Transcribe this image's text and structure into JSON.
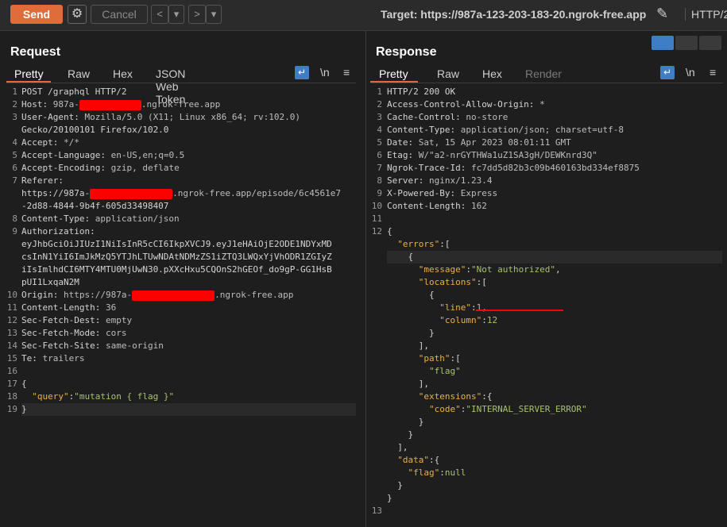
{
  "toolbar": {
    "send_label": "Send",
    "gear_glyph": "⚙",
    "cancel_label": "Cancel",
    "back_glyph": "<",
    "back_drop_glyph": "▾",
    "fwd_glyph": ">",
    "fwd_drop_glyph": "▾",
    "target_text": "Target: https://987a-123-203-183-20.ngrok-free.app",
    "pencil_glyph": "✎",
    "protocol": "HTTP/2"
  },
  "request": {
    "title": "Request",
    "tabs": [
      "Pretty",
      "Raw",
      "Hex",
      "JSON Web Token"
    ],
    "wrap_icon_glyph": "↵",
    "newline_icon": "\\n",
    "menu_glyph": "≡",
    "line_numbers": [
      "1",
      "2",
      "3",
      "",
      "4",
      "5",
      "6",
      "7",
      "",
      "",
      "8",
      "9",
      "",
      "",
      "",
      "",
      "10",
      "11",
      "12",
      "13",
      "14",
      "15",
      "16",
      "17",
      "18",
      "19"
    ],
    "lines": [
      {
        "t": "POST /graphql HTTP/2"
      },
      {
        "k": "Host",
        "v": "987a-",
        "r": 78,
        "v2": ".ngrok-free.app"
      },
      {
        "k": "User-Agent",
        "v": "Mozilla/5.0 (X11; Linux x86_64; rv:102.0)"
      },
      {
        "t": "Gecko/20100101 Firefox/102.0"
      },
      {
        "k": "Accept",
        "v": "*/*"
      },
      {
        "k": "Accept-Language",
        "v": "en-US,en;q=0.5"
      },
      {
        "k": "Accept-Encoding",
        "v": "gzip, deflate"
      },
      {
        "k": "Referer",
        "v": ""
      },
      {
        "t": "https://987a-",
        "r": 104,
        "v2": ".ngrok-free.app/episode/6c4561e7"
      },
      {
        "t": "-2d88-4844-9b4f-605d33498407"
      },
      {
        "k": "Content-Type",
        "v": "application/json"
      },
      {
        "k": "Authorization",
        "v": ""
      },
      {
        "t": "eyJhbGciOiJIUzI1NiIsInR5cCI6IkpXVCJ9.eyJ1eHAiOjE2ODE1NDYxMD"
      },
      {
        "t": "csInN1YiI6ImJkMzQ5YTJhLTUwNDAtNDMzZS1iZTQ3LWQxYjVhODR1ZGIyZ"
      },
      {
        "t": "iIsImlhdCI6MTY4MTU0MjUwN30.pXXcHxu5CQOnS2hGEOf_do9gP-GG1HsB"
      },
      {
        "t": "pUI1LxqaN2M"
      },
      {
        "k": "Origin",
        "v": "https://987a-",
        "r": 104,
        "v2": ".ngrok-free.app"
      },
      {
        "k": "Content-Length",
        "v": "36"
      },
      {
        "k": "Sec-Fetch-Dest",
        "v": "empty"
      },
      {
        "k": "Sec-Fetch-Mode",
        "v": "cors"
      },
      {
        "k": "Sec-Fetch-Site",
        "v": "same-origin"
      },
      {
        "k": "Te",
        "v": "trailers"
      },
      {
        "t": ""
      },
      {
        "t": "{"
      },
      {
        "json": "  \"query\":\"mutation { flag }\""
      },
      {
        "t": "}",
        "hl": true
      }
    ]
  },
  "response": {
    "title": "Response",
    "tabs": [
      "Pretty",
      "Raw",
      "Hex",
      "Render"
    ],
    "wrap_icon_glyph": "↵",
    "newline_icon": "\\n",
    "menu_glyph": "≡",
    "line_numbers": [
      "1",
      "2",
      "3",
      "4",
      "5",
      "6",
      "7",
      "8",
      "9",
      "10",
      "11",
      "12",
      "",
      "",
      "",
      "",
      "",
      "",
      "",
      "",
      "",
      "",
      "",
      "",
      "",
      "",
      "",
      "",
      "",
      "",
      "",
      "",
      "",
      "13"
    ],
    "lines": [
      {
        "t": "HTTP/2 200 OK"
      },
      {
        "k": "Access-Control-Allow-Origin",
        "v": "*"
      },
      {
        "k": "Cache-Control",
        "v": "no-store"
      },
      {
        "k": "Content-Type",
        "v": "application/json; charset=utf-8"
      },
      {
        "k": "Date",
        "v": "Sat, 15 Apr 2023 08:01:11 GMT"
      },
      {
        "k": "Etag",
        "v": "W/\"a2-nrGYTHWa1uZ1SA3gH/DEWKnrd3Q\""
      },
      {
        "k": "Ngrok-Trace-Id",
        "v": "fc7dd5d82b3c09b460163bd334ef8875"
      },
      {
        "k": "Server",
        "v": "nginx/1.23.4"
      },
      {
        "k": "X-Powered-By",
        "v": "Express"
      },
      {
        "k": "Content-Length",
        "v": "162"
      },
      {
        "t": ""
      },
      {
        "t": "{"
      },
      {
        "j": [
          [
            "p",
            "  "
          ],
          [
            "key",
            "\"errors\""
          ],
          [
            "p",
            ":["
          ]
        ]
      },
      {
        "j": [
          [
            "p",
            "    {"
          ]
        ],
        "hl": true
      },
      {
        "j": [
          [
            "p",
            "      "
          ],
          [
            "key",
            "\"message\""
          ],
          [
            "p",
            ":"
          ],
          [
            "str",
            "\"Not authorized\""
          ],
          [
            "p",
            ","
          ]
        ]
      },
      {
        "j": [
          [
            "p",
            "      "
          ],
          [
            "key",
            "\"locations\""
          ],
          [
            "p",
            ":["
          ]
        ]
      },
      {
        "j": [
          [
            "p",
            "        {"
          ]
        ]
      },
      {
        "j": [
          [
            "p",
            "          "
          ],
          [
            "key",
            "\"line\""
          ],
          [
            "p",
            ":"
          ],
          [
            "num",
            "1"
          ],
          [
            "p",
            ","
          ]
        ]
      },
      {
        "j": [
          [
            "p",
            "          "
          ],
          [
            "key",
            "\"column\""
          ],
          [
            "p",
            ":"
          ],
          [
            "num",
            "12"
          ]
        ]
      },
      {
        "j": [
          [
            "p",
            "        }"
          ]
        ]
      },
      {
        "j": [
          [
            "p",
            "      ],"
          ]
        ]
      },
      {
        "j": [
          [
            "p",
            "      "
          ],
          [
            "key",
            "\"path\""
          ],
          [
            "p",
            ":["
          ]
        ]
      },
      {
        "j": [
          [
            "p",
            "        "
          ],
          [
            "str",
            "\"flag\""
          ]
        ]
      },
      {
        "j": [
          [
            "p",
            "      ],"
          ]
        ]
      },
      {
        "j": [
          [
            "p",
            "      "
          ],
          [
            "key",
            "\"extensions\""
          ],
          [
            "p",
            ":{"
          ]
        ]
      },
      {
        "j": [
          [
            "p",
            "        "
          ],
          [
            "key",
            "\"code\""
          ],
          [
            "p",
            ":"
          ],
          [
            "str",
            "\"INTERNAL_SERVER_ERROR\""
          ]
        ]
      },
      {
        "j": [
          [
            "p",
            "      }"
          ]
        ]
      },
      {
        "j": [
          [
            "p",
            "    }"
          ]
        ]
      },
      {
        "j": [
          [
            "p",
            "  ],"
          ]
        ]
      },
      {
        "j": [
          [
            "p",
            "  "
          ],
          [
            "key",
            "\"data\""
          ],
          [
            "p",
            ":{"
          ]
        ]
      },
      {
        "j": [
          [
            "p",
            "    "
          ],
          [
            "key",
            "\"flag\""
          ],
          [
            "p",
            ":"
          ],
          [
            "num",
            "null"
          ]
        ]
      },
      {
        "j": [
          [
            "p",
            "  }"
          ]
        ]
      },
      {
        "j": [
          [
            "p",
            "}"
          ]
        ]
      },
      {
        "t": ""
      }
    ]
  },
  "colors": {
    "accent": "#e06c3c",
    "key": "#e8b14a",
    "string": "#a6c36b",
    "redaction": "#ff0000"
  }
}
